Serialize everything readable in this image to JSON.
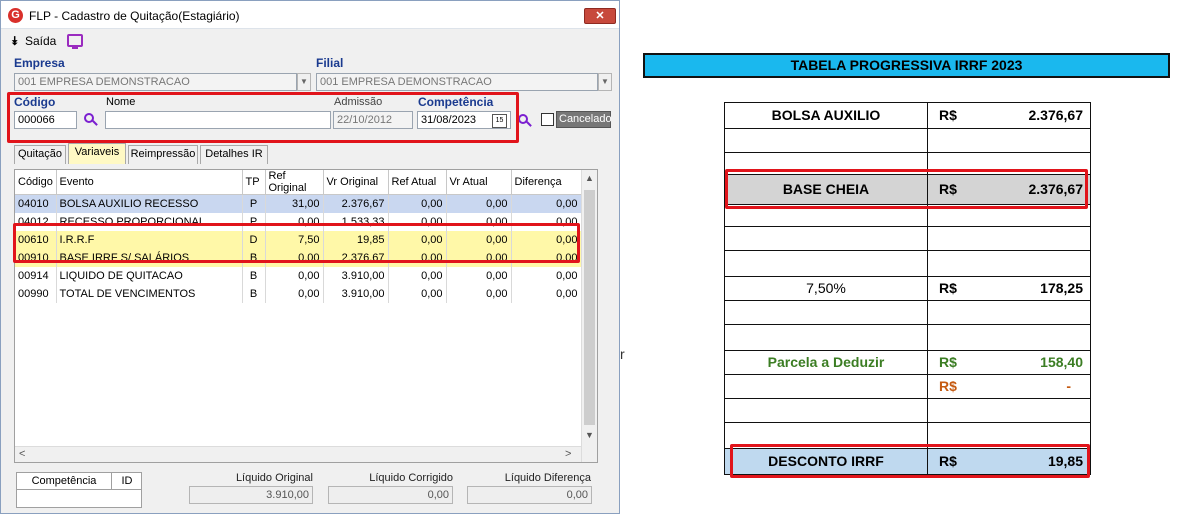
{
  "window": {
    "logo": "G",
    "title": "FLP - Cadastro de Quitação(Estagiário)",
    "close_glyph": "✕",
    "menu_exit": "Saída",
    "icons": {
      "exit": "exit-arrow-icon",
      "monitor": "monitor-icon"
    }
  },
  "form": {
    "empresa_label": "Empresa",
    "empresa_value": "001 EMPRESA DEMONSTRACAO",
    "filial_label": "Filial",
    "filial_value": "001 EMPRESA DEMONSTRACAO",
    "codigo_label": "Código",
    "codigo_value": "000066",
    "nome_label": "Nome",
    "nome_value": "",
    "admissao_label": "Admissão",
    "admissao_value": "22/10/2012",
    "competencia_label": "Competência",
    "competencia_value": "31/08/2023",
    "calendar_glyph": "15",
    "cancelado_label": "Cancelado"
  },
  "tabs": [
    {
      "label": "Quitação"
    },
    {
      "label": "Variaveis"
    },
    {
      "label": "Reimpressão"
    },
    {
      "label": "Detalhes IR"
    }
  ],
  "grid": {
    "columns": [
      "Código",
      "Evento",
      "TP",
      "Ref Original",
      "Vr Original",
      "Ref Atual",
      "Vr Atual",
      "Diferença"
    ],
    "rows": [
      [
        "04010",
        "BOLSA AUXILIO RECESSO",
        "P",
        "31,00",
        "2.376,67",
        "0,00",
        "0,00",
        "0,00"
      ],
      [
        "04012",
        "RECESSO PROPORCIONAL",
        "P",
        "0,00",
        "1.533,33",
        "0,00",
        "0,00",
        "0,00"
      ],
      [
        "00610",
        "I.R.R.F",
        "D",
        "7,50",
        "19,85",
        "0,00",
        "0,00",
        "0,00"
      ],
      [
        "00910",
        "BASE IRRF S/ SALÁRIOS",
        "B",
        "0,00",
        "2.376,67",
        "0,00",
        "0,00",
        "0,00"
      ],
      [
        "00914",
        "LIQUIDO DE QUITACAO",
        "B",
        "0,00",
        "3.910,00",
        "0,00",
        "0,00",
        "0,00"
      ],
      [
        "00990",
        "TOTAL DE VENCIMENTOS",
        "B",
        "0,00",
        "3.910,00",
        "0,00",
        "0,00",
        "0,00"
      ]
    ]
  },
  "bottom": {
    "competencia_header": "Competência",
    "id_header": "ID",
    "liquido_original_label": "Líquido Original",
    "liquido_original_value": "3.910,00",
    "liquido_corrigido_label": "Líquido Corrigido",
    "liquido_corrigido_value": "0,00",
    "liquido_diferenca_label": "Líquido Diferença",
    "liquido_diferenca_value": "0,00"
  },
  "irrf_table": {
    "title": "TABELA PROGRESSIVA IRRF 2023",
    "currency": "R$",
    "bolsa_label": "BOLSA AUXILIO",
    "bolsa_value": "2.376,67",
    "base_label": "BASE CHEIA",
    "base_value": "2.376,67",
    "aliquota_label": "7,50%",
    "aliquota_value": "178,25",
    "parcela_label": "Parcela a Deduzir",
    "parcela_value": "158,40",
    "dash_value": "-",
    "desconto_label": "DESCONTO IRRF",
    "desconto_value": "19,85",
    "colors": {
      "title_bg": "#1ab8ee",
      "base_bg": "#d4d4d4",
      "desconto_bg": "#bfd9ef",
      "green": "#3b7d23",
      "orange": "#c55a11",
      "highlight": "#e1141b"
    }
  },
  "stray_char": "r"
}
